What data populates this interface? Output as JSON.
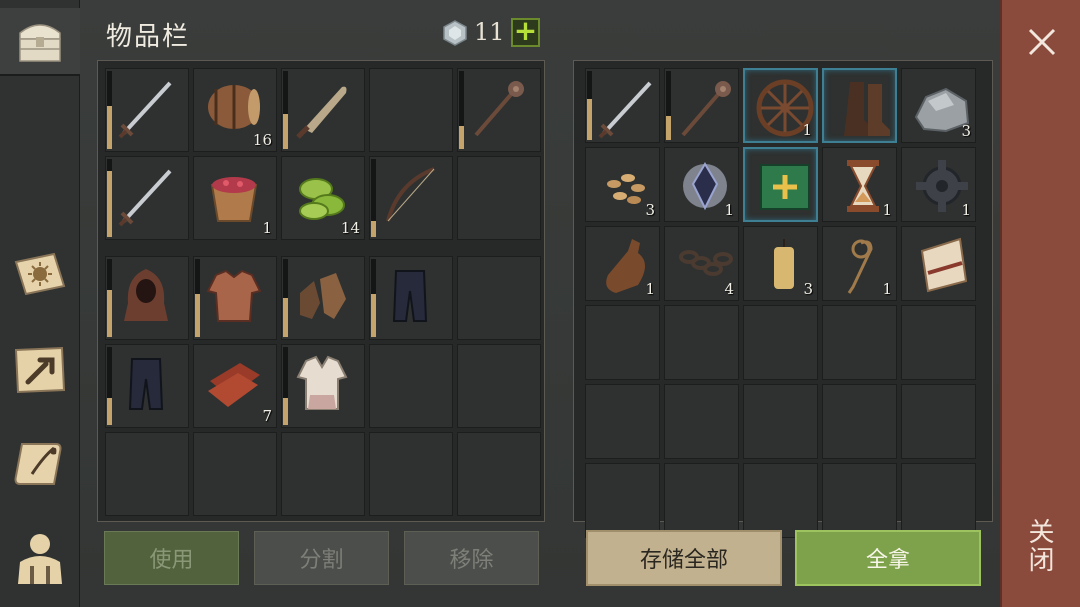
{
  "header": {
    "title": "物品栏",
    "gem_count": "11",
    "add_label": "+"
  },
  "left_inventory": {
    "rows": [
      [
        {
          "icon": "sword-icon",
          "count": "",
          "durability": 0.55
        },
        {
          "icon": "barrel-icon",
          "count": "16"
        },
        {
          "icon": "machete-icon",
          "count": "",
          "durability": 0.45
        },
        {
          "icon": "",
          "count": ""
        },
        {
          "icon": "mace-icon",
          "count": "",
          "durability": 0.3
        }
      ],
      [
        {
          "icon": "sword-icon",
          "count": "",
          "durability": 0.85
        },
        {
          "icon": "berry-bucket-icon",
          "count": "1"
        },
        {
          "icon": "plant-fiber-icon",
          "count": "14"
        },
        {
          "icon": "bow-icon",
          "count": "",
          "durability": 0.2
        },
        {
          "icon": "",
          "count": ""
        }
      ],
      [
        {
          "icon": "hood-icon",
          "count": "",
          "durability": 0.6
        },
        {
          "icon": "chainmail-icon",
          "count": "",
          "durability": 0.55
        },
        {
          "icon": "gloves-icon",
          "count": "",
          "durability": 0.5
        },
        {
          "icon": "pants-icon",
          "count": "",
          "durability": 0.55
        },
        {
          "icon": "",
          "count": ""
        }
      ],
      [
        {
          "icon": "pants-icon",
          "count": "",
          "durability": 0.35
        },
        {
          "icon": "leather-icon",
          "count": "7"
        },
        {
          "icon": "shirt-icon",
          "count": "",
          "durability": 0.35
        },
        {
          "icon": "",
          "count": ""
        },
        {
          "icon": "",
          "count": ""
        }
      ],
      [
        {
          "icon": "",
          "count": ""
        },
        {
          "icon": "",
          "count": ""
        },
        {
          "icon": "",
          "count": ""
        },
        {
          "icon": "",
          "count": ""
        },
        {
          "icon": "",
          "count": ""
        }
      ]
    ]
  },
  "right_inventory": {
    "rows": [
      [
        {
          "icon": "sword-icon",
          "count": "",
          "durability": 0.6
        },
        {
          "icon": "mace-icon",
          "count": "",
          "durability": 0.35
        },
        {
          "icon": "wheel-icon",
          "count": "1",
          "selected": true
        },
        {
          "icon": "boots-icon",
          "count": "",
          "selected": true
        },
        {
          "icon": "stone-icon",
          "count": "3"
        }
      ],
      [
        {
          "icon": "seeds-icon",
          "count": "3"
        },
        {
          "icon": "crystal-icon",
          "count": "1"
        },
        {
          "icon": "book-icon",
          "count": "",
          "selected": true
        },
        {
          "icon": "hourglass-icon",
          "count": "1"
        },
        {
          "icon": "gear-icon",
          "count": "1"
        }
      ],
      [
        {
          "icon": "bottle-icon",
          "count": "1"
        },
        {
          "icon": "chain-icon",
          "count": "4"
        },
        {
          "icon": "candle-icon",
          "count": "3"
        },
        {
          "icon": "rope-icon",
          "count": "1"
        },
        {
          "icon": "scroll-icon",
          "count": ""
        }
      ],
      [
        {
          "icon": "",
          "count": ""
        },
        {
          "icon": "",
          "count": ""
        },
        {
          "icon": "",
          "count": ""
        },
        {
          "icon": "",
          "count": ""
        },
        {
          "icon": "",
          "count": ""
        }
      ],
      [
        {
          "icon": "",
          "count": ""
        },
        {
          "icon": "",
          "count": ""
        },
        {
          "icon": "",
          "count": ""
        },
        {
          "icon": "",
          "count": ""
        },
        {
          "icon": "",
          "count": ""
        }
      ],
      [
        {
          "icon": "",
          "count": ""
        },
        {
          "icon": "",
          "count": ""
        },
        {
          "icon": "",
          "count": ""
        },
        {
          "icon": "",
          "count": ""
        },
        {
          "icon": "",
          "count": ""
        }
      ]
    ]
  },
  "buttons": {
    "use": "使用",
    "split": "分割",
    "remove": "移除",
    "store_all": "存储全部",
    "take_all": "全拿"
  },
  "close": {
    "label": "关闭"
  },
  "rail": [
    "chest-icon",
    "sun-book-icon",
    "crafting-icon",
    "quest-scroll-icon",
    "character-icon"
  ],
  "colors": {
    "accent_green": "#7ea24c",
    "close_red": "#8a4a3c",
    "durability": "#c4a46a",
    "selected_blue": "#3f7f94"
  }
}
